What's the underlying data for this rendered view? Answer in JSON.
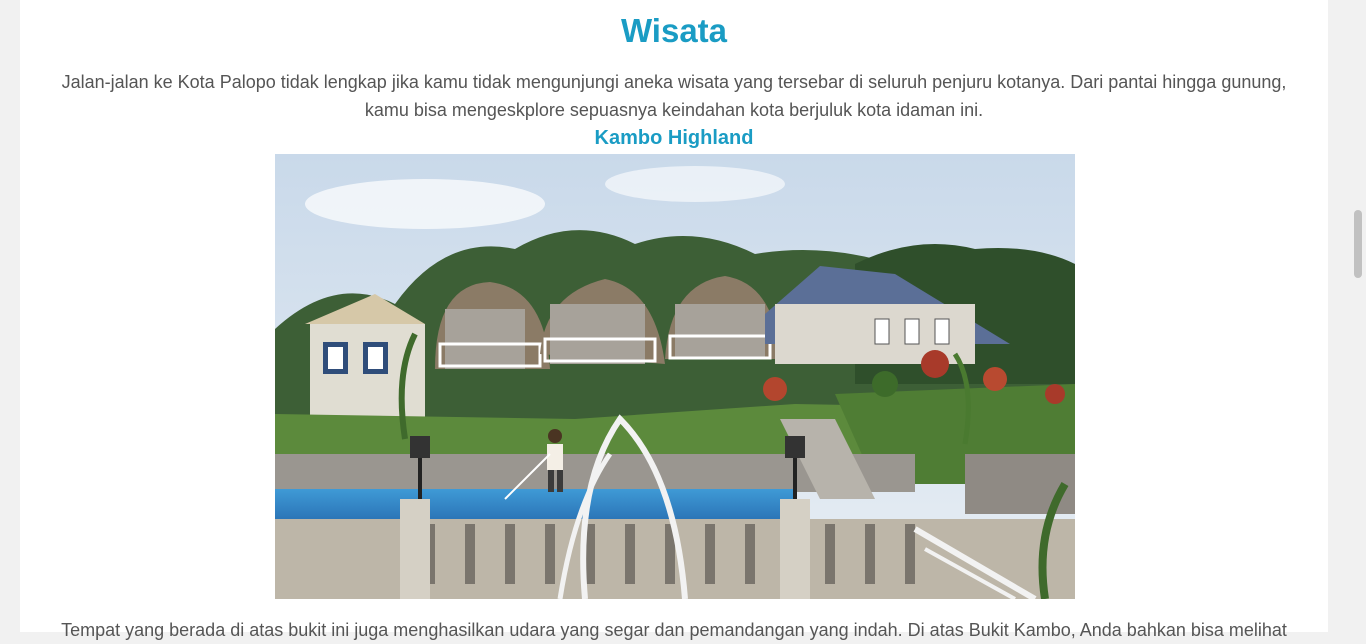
{
  "section": {
    "title": "Wisata",
    "intro": "Jalan-jalan ke Kota Palopo tidak lengkap jika kamu tidak mengunjungi aneka wisata yang tersebar di seluruh penjuru kotanya. Dari pantai hingga gunung, kamu bisa mengeskplore sepuasnya keindahan kota berjuluk kota idaman ini."
  },
  "destination": {
    "name": "Kambo Highland",
    "photo_icon": "resort-photo",
    "description": "Tempat yang berada di atas bukit ini juga menghasilkan udara yang segar dan pemandangan yang indah. Di atas Bukit Kambo, Anda bahkan bisa melihat"
  },
  "colors": {
    "accent": "#1a9cc4",
    "text": "#555555",
    "background": "#ffffff",
    "page_bg": "#f1f1f1"
  }
}
